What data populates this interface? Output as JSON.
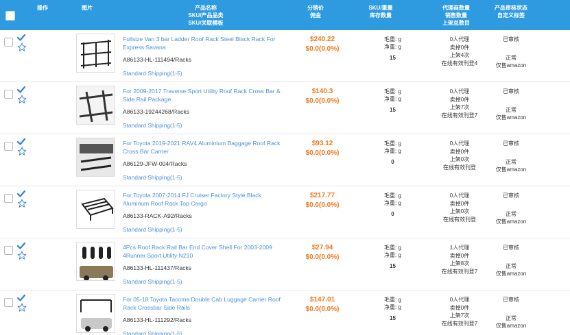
{
  "header": {
    "operation": "操作",
    "image": "图片",
    "product_name": "产品名称",
    "sku_category": "SKU/产品品类",
    "sku_template": "SKU/关联模板",
    "dist_price": "分销价",
    "commission": "佣金",
    "sku_weight": "SKU/重量",
    "stock_qty": "库存数量",
    "agent_qty": "代理商数量",
    "sales_qty": "销售数量",
    "listing_total": "上架总数目",
    "review_status": "产品审核状态",
    "custom_tag": "自定义标签"
  },
  "labels": {
    "gross_weight": "毛重: g",
    "net_weight": "净重: g"
  },
  "colors": {
    "header_bg": "#2e9be0",
    "link": "#4a90d6",
    "price": "#f0781e"
  },
  "rows": [
    {
      "title": "Fullsize Van 3 bar Ladder Roof Rack Steel Black Rack For Express Savana",
      "sku": "A86133-HL-111494/Racks",
      "shipping": "Standard Shipping(1-5)",
      "price": "$240.22",
      "commission": "$0.0(0.0%)",
      "stock": "15",
      "agents": "0人代理",
      "sold": "卖掉0件",
      "listed": "上架4次",
      "active": "在线有效刊登4",
      "review": "已审核",
      "status": "正常",
      "tag": "仅售amazon"
    },
    {
      "title": "For 2009-2017 Traverse Sport Utility Roof Rack Cross Bar & Side Rail Package",
      "sku": "A86133-19244268/Racks",
      "shipping": "Standard Shipping(1-5)",
      "price": "$140.3",
      "commission": "$0.0(0.0%)",
      "stock": "15",
      "agents": "0人代理",
      "sold": "卖掉0件",
      "listed": "上架7次",
      "active": "在线有效刊登7",
      "review": "已审核",
      "status": "正常",
      "tag": "仅售amazon"
    },
    {
      "title": "For Toyota 2019-2021 RAV4 Aluminium Baggage Roof Rack Cross Bar Carrier",
      "sku": "A86129-JFW-004/Racks",
      "shipping": "Standard Shipping(1-5)",
      "price": "$93.12",
      "commission": "$0.0(0.0%)",
      "stock": "0",
      "agents": "0人代理",
      "sold": "卖掉0件",
      "listed": "上架0次",
      "active": "在线有效刊登",
      "review": "已审核",
      "status": "正常",
      "tag": "仅售amazon"
    },
    {
      "title": "For Toyota 2007-2014 FJ Cruiser Factory Style Black Aluminum Roof Rack Top Cargo",
      "sku": "A86133-RACK-A92/Racks",
      "shipping": "Standard Shipping(1-5)",
      "price": "$217.77",
      "commission": "$0.0(0.0%)",
      "stock": "0",
      "agents": "0人代理",
      "sold": "卖掉0件",
      "listed": "上架0次",
      "active": "在线有效刊登",
      "review": "已审核",
      "status": "正常",
      "tag": "仅售amazon"
    },
    {
      "title": "4Pcs Roof Rack Rail Bar End Cover Shell For 2003-2009 4Runner Sport Utility N210",
      "sku": "A86133-HL-111437/Racks",
      "shipping": "Standard Shipping(1-5)",
      "price": "$27.94",
      "commission": "$0.0(0.0%)",
      "stock": "15",
      "agents": "1人代理",
      "sold": "卖掉0件",
      "listed": "上架8次",
      "active": "在线有效刊登7",
      "review": "已审核",
      "status": "正常",
      "tag": "仅售amazon"
    },
    {
      "title": "For 05-18 Toyota Tacoma Double Cab Luggage Carrier Roof Rack Crossbar Side Rails",
      "sku": "A86133-HL-111292/Racks",
      "shipping": "Standard Shipping(1-5)",
      "price": "$147.01",
      "commission": "$0.0(0.0%)",
      "stock": "15",
      "agents": "0人代理",
      "sold": "卖掉0件",
      "listed": "上架7次",
      "active": "在线有效刊登7",
      "review": "已审核",
      "status": "正常",
      "tag": "仅售amazon"
    }
  ]
}
